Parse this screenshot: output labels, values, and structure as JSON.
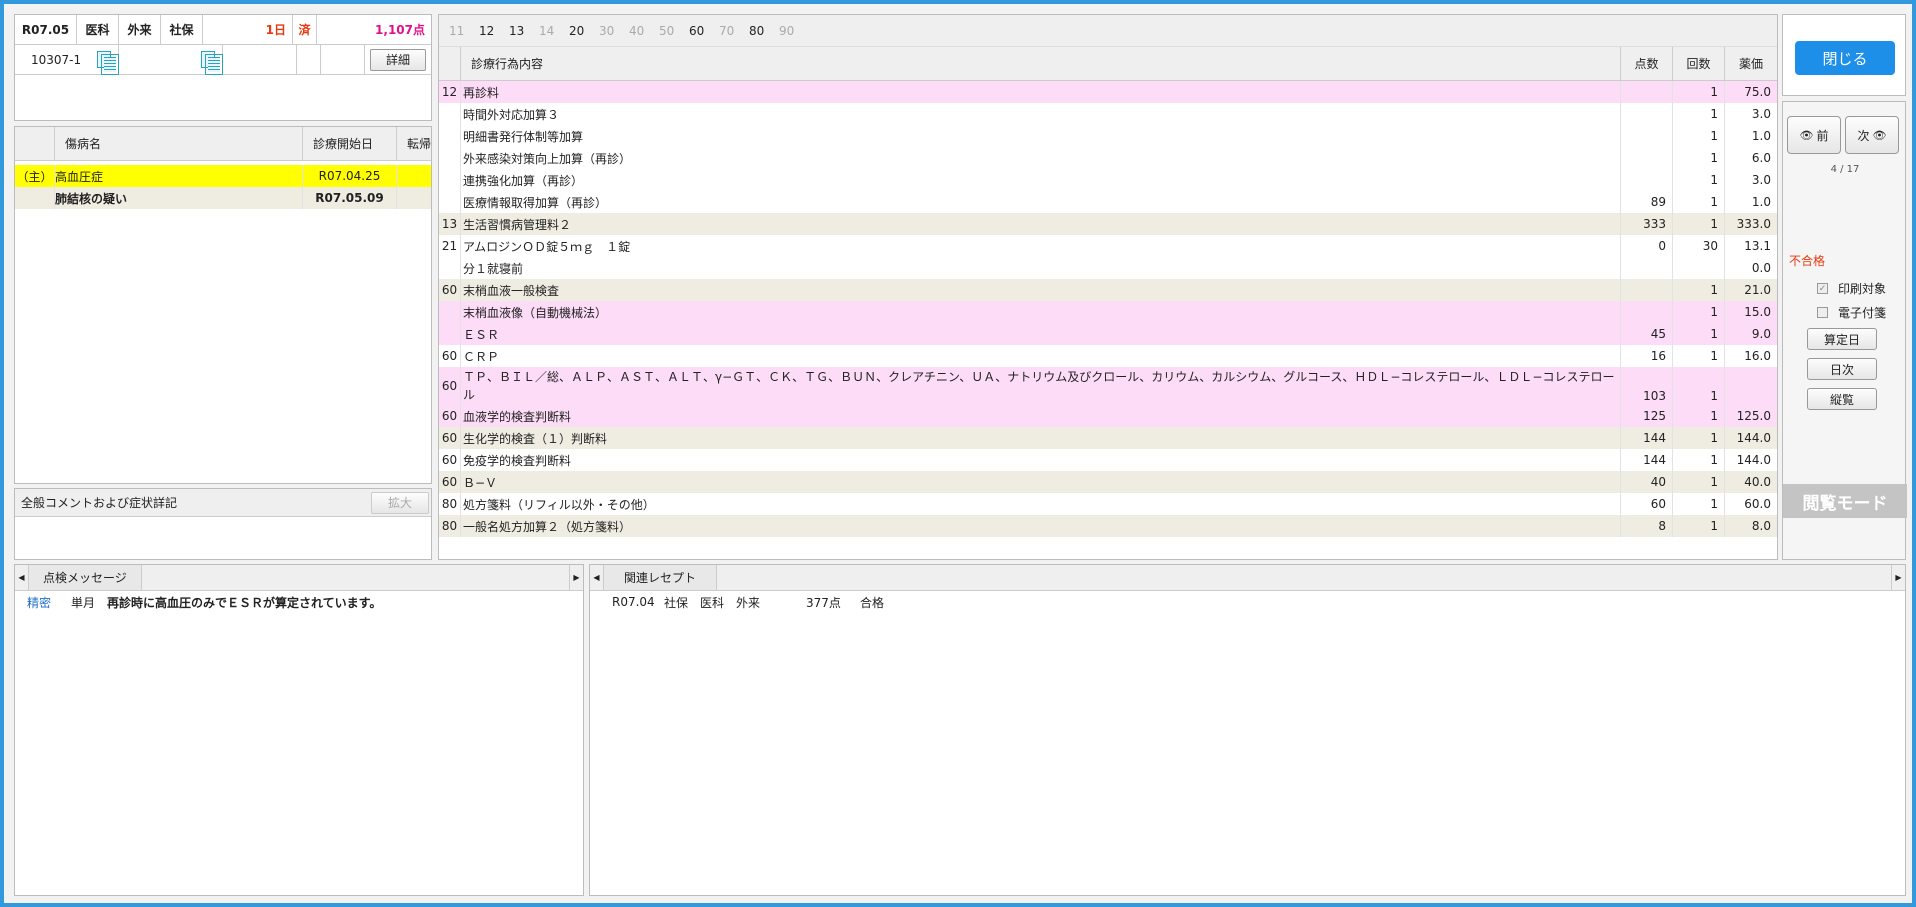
{
  "header": {
    "date": "R07.05",
    "dept": "医科",
    "inout": "外来",
    "insurance": "社保",
    "days": "1日",
    "done": "済",
    "points": "1,107点",
    "patient_no": "10307-1",
    "detail_btn": "詳細"
  },
  "disease": {
    "headers": [
      "傷病名",
      "診療開始日",
      "転帰"
    ],
    "rows": [
      {
        "tag": "（主）",
        "name": "高血圧症",
        "start": "R07.04.25",
        "outcome": ""
      },
      {
        "tag": "",
        "name": "肺結核の疑い",
        "start": "R07.05.09",
        "outcome": ""
      }
    ]
  },
  "comment": {
    "label": "全般コメントおよび症状詳記",
    "expand_btn": "拡大"
  },
  "code_filter": [
    "11",
    "12",
    "13",
    "14",
    "20",
    "30",
    "40",
    "50",
    "60",
    "70",
    "80",
    "90"
  ],
  "list": {
    "headers": {
      "name": "診療行為内容",
      "points": "点数",
      "count": "回数",
      "drug": "薬価"
    },
    "rows": [
      {
        "code": "12",
        "name": "再診料",
        "points": "",
        "count": "1",
        "drug": "75.0",
        "bg": "pink"
      },
      {
        "code": "",
        "name": "時間外対応加算３",
        "points": "",
        "count": "1",
        "drug": "3.0",
        "bg": "white"
      },
      {
        "code": "",
        "name": "明細書発行体制等加算",
        "points": "",
        "count": "1",
        "drug": "1.0",
        "bg": "white"
      },
      {
        "code": "",
        "name": "外来感染対策向上加算（再診）",
        "points": "",
        "count": "1",
        "drug": "6.0",
        "bg": "white"
      },
      {
        "code": "",
        "name": "連携強化加算（再診）",
        "points": "",
        "count": "1",
        "drug": "3.0",
        "bg": "white"
      },
      {
        "code": "",
        "name": "医療情報取得加算（再診）",
        "points": "89",
        "count": "1",
        "drug": "1.0",
        "bg": "white"
      },
      {
        "code": "13",
        "name": "生活習慣病管理料２",
        "points": "333",
        "count": "1",
        "drug": "333.0",
        "bg": "beige"
      },
      {
        "code": "21",
        "name": "アムロジンＯＤ錠５ｍｇ　１錠",
        "points": "0",
        "count": "30",
        "drug": "13.1",
        "bg": "white"
      },
      {
        "code": "",
        "name": "分１就寝前",
        "points": "",
        "count": "",
        "drug": "0.0",
        "bg": "white"
      },
      {
        "code": "60",
        "name": "末梢血液一般検査",
        "points": "",
        "count": "1",
        "drug": "21.0",
        "bg": "beige"
      },
      {
        "code": "",
        "name": "末梢血液像（自動機械法）",
        "points": "",
        "count": "1",
        "drug": "15.0",
        "bg": "pink"
      },
      {
        "code": "",
        "name": "ＥＳＲ",
        "points": "45",
        "count": "1",
        "drug": "9.0",
        "bg": "pink"
      },
      {
        "code": "60",
        "name": "ＣＲＰ",
        "points": "16",
        "count": "1",
        "drug": "16.0",
        "bg": "white"
      },
      {
        "code": "60",
        "name": "ＴＰ、ＢＩＬ／総、ＡＬＰ、ＡＳＴ、ＡＬＴ、γ−ＧＴ、ＣＫ、ＴＧ、ＢＵＮ、クレアチニン、ＵＡ、ナトリウム及びクロール、カリウム、カルシウム、グルコース、ＨＤＬ−コレステロール、ＬＤＬ−コレステロール",
        "points": "103",
        "count": "1",
        "drug": "",
        "bg": "pink",
        "tall": true
      },
      {
        "code": "60",
        "name": "血液学的検査判断料",
        "points": "125",
        "count": "1",
        "drug": "125.0",
        "bg": "pink"
      },
      {
        "code": "60",
        "name": "生化学的検査（１）判断料",
        "points": "144",
        "count": "1",
        "drug": "144.0",
        "bg": "beige"
      },
      {
        "code": "60",
        "name": "免疫学的検査判断料",
        "points": "144",
        "count": "1",
        "drug": "144.0",
        "bg": "white"
      },
      {
        "code": "60",
        "name": "Ｂ−Ｖ",
        "points": "40",
        "count": "1",
        "drug": "40.0",
        "bg": "beige"
      },
      {
        "code": "80",
        "name": "処方箋料（リフィル以外・その他）",
        "points": "60",
        "count": "1",
        "drug": "60.0",
        "bg": "white"
      },
      {
        "code": "80",
        "name": "一般名処方加算２（処方箋料）",
        "points": "8",
        "count": "1",
        "drug": "8.0",
        "bg": "beige"
      }
    ]
  },
  "right": {
    "close_btn": "閉じる",
    "prev_btn": "前",
    "next_btn": "次",
    "page": "4 / 17",
    "status": "不合格",
    "print_target": "印刷対象",
    "e_attach": "電子付箋",
    "calc_date_btn": "算定日",
    "daily_btn": "日次",
    "vertical_btn": "縦覧",
    "mode_label": "閲覧モード"
  },
  "messages": {
    "tab": "点検メッセージ",
    "items": [
      {
        "level": "精密",
        "period": "単月",
        "text": "再診時に高血圧のみでＥＳＲが算定されています。"
      }
    ]
  },
  "related": {
    "tab": "関連レセプト",
    "items": [
      {
        "date": "R07.04",
        "insurance": "社保",
        "dept": "医科",
        "inout": "外来",
        "points": "377点",
        "result": "合格"
      }
    ]
  },
  "colors": {
    "accent": "#1e8fe8",
    "pink_row": "#fddcf7",
    "beige_row": "#efede2",
    "main_disease": "#ffff00"
  }
}
